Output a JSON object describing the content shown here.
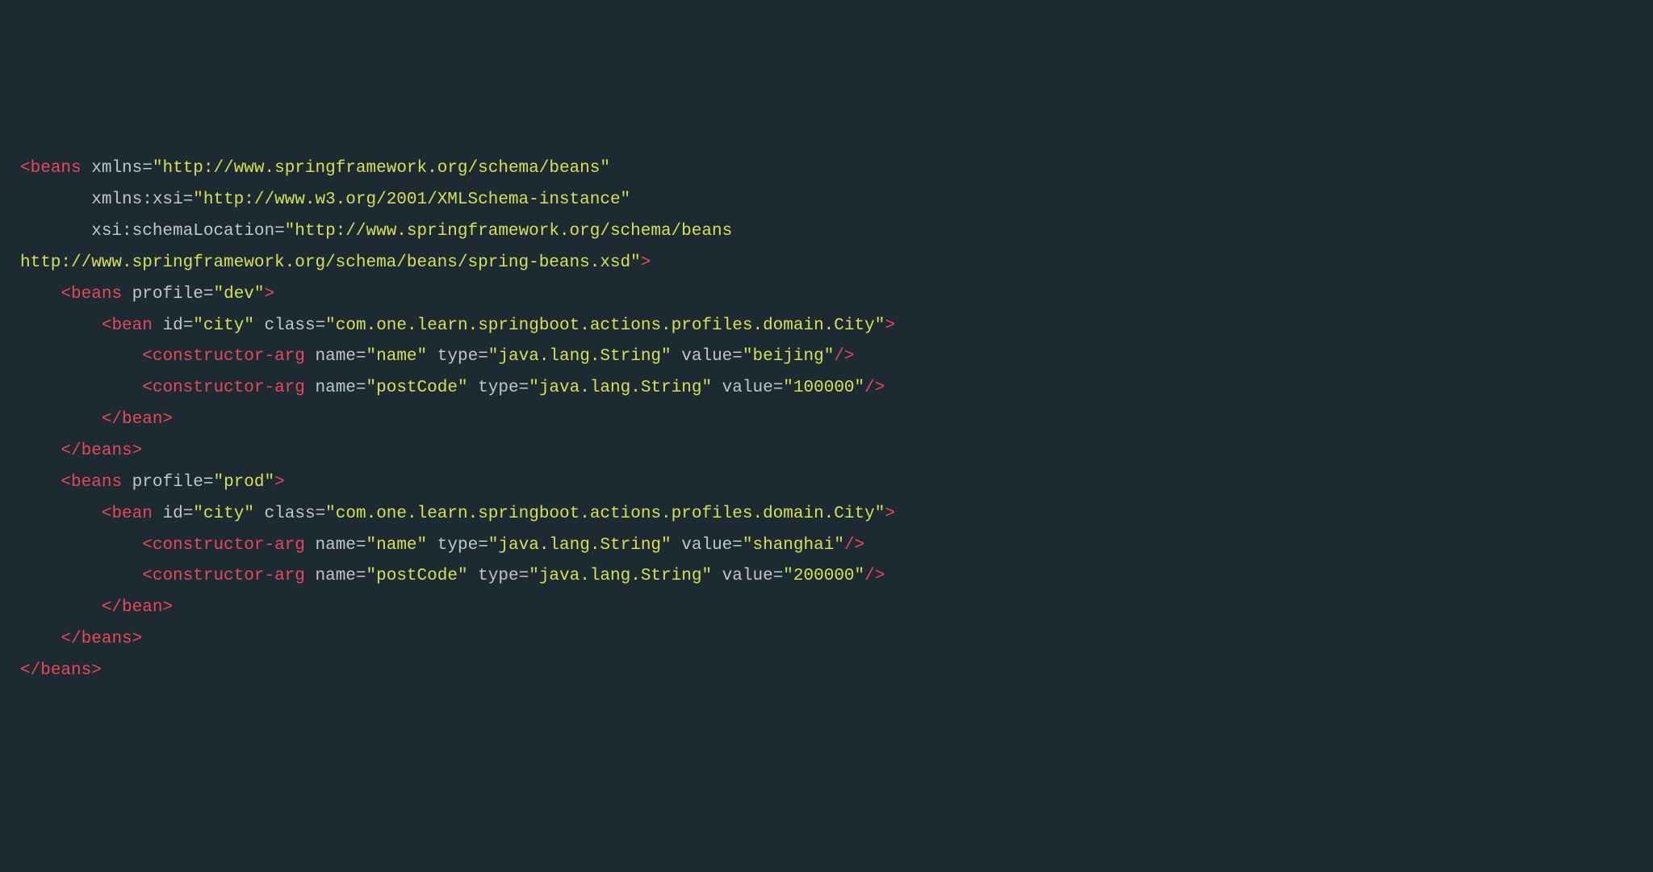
{
  "colors": {
    "background": "#1e2a32",
    "tag": "#e5495a",
    "attrName": "#c0c5ce",
    "attrValue": "#d4e157"
  },
  "code": {
    "xmlns": "http://www.springframework.org/schema/beans",
    "xmlnsXsi": "http://www.w3.org/2001/XMLSchema-instance",
    "schemaLocation": "http://www.springframework.org/schema/beans http://www.springframework.org/schema/beans/spring-beans.xsd",
    "profiles": [
      {
        "name": "dev",
        "bean": {
          "id": "city",
          "class": "com.one.learn.springboot.actions.profiles.domain.City",
          "constructorArgs": [
            {
              "name": "name",
              "type": "java.lang.String",
              "value": "beijing"
            },
            {
              "name": "postCode",
              "type": "java.lang.String",
              "value": "100000"
            }
          ]
        }
      },
      {
        "name": "prod",
        "bean": {
          "id": "city",
          "class": "com.one.learn.springboot.actions.profiles.domain.City",
          "constructorArgs": [
            {
              "name": "name",
              "type": "java.lang.String",
              "value": "shanghai"
            },
            {
              "name": "postCode",
              "type": "java.lang.String",
              "value": "200000"
            }
          ]
        }
      }
    ]
  },
  "tokens": {
    "beans": "beans",
    "bean": "bean",
    "constructorArg": "constructor-arg",
    "xmlnsAttr": "xmlns",
    "xmlnsXsiAttr": "xmlns:xsi",
    "schemaLocationAttr": "xsi:schemaLocation",
    "profileAttr": "profile",
    "idAttr": "id",
    "classAttr": "class",
    "nameAttr": "name",
    "typeAttr": "type",
    "valueAttr": "value",
    "schemaLoc1": "http://www.springframework.org/schema/beans",
    "schemaLoc2": "http://www.springframework.org/schema/beans/spring-beans.xsd"
  }
}
